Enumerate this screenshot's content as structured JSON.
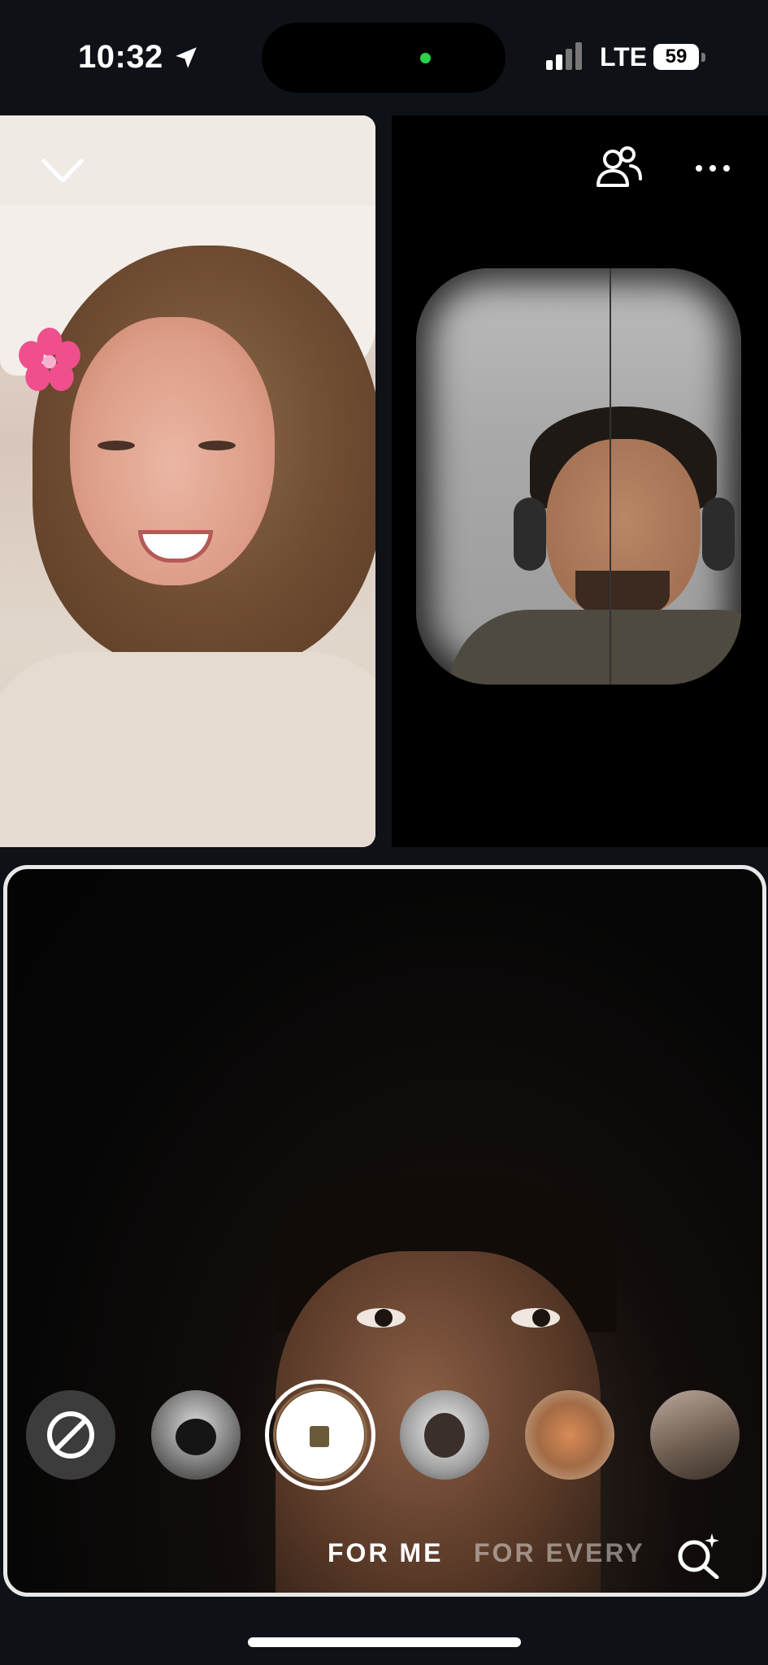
{
  "status_bar": {
    "time": "10:32",
    "network": "LTE",
    "battery": "59",
    "icons": [
      "location-arrow-icon",
      "signal-bars-icon",
      "battery-icon"
    ]
  },
  "call": {
    "controls": [
      "minimize-chevron-icon",
      "participants-icon",
      "more-options-icon"
    ],
    "participants": 3
  },
  "effects": {
    "items": [
      "no-effect",
      "effect-1",
      "effect-film-selected",
      "effect-2",
      "effect-3",
      "effect-4"
    ],
    "tabs": {
      "for_me": "FOR ME",
      "for_everyone": "FOR EVERYONE"
    },
    "selected_tab": "FOR ME"
  },
  "colors": {
    "background": "#0e1116",
    "active_dot": "#2bd14a",
    "self_view_border": "#e8e8e8"
  }
}
